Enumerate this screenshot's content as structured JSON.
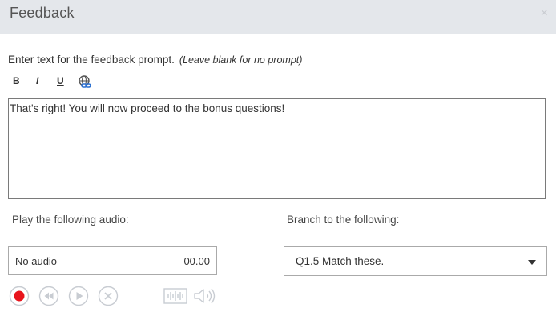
{
  "dialog": {
    "title": "Feedback",
    "close_glyph": "×"
  },
  "prompt": {
    "label": "Enter text for the feedback prompt.",
    "hint": "(Leave blank for no prompt)",
    "text": "That's right!  You will now proceed to the bonus questions!"
  },
  "toolbar": {
    "bold": "B",
    "italic": "I",
    "underline": "U",
    "link_icon": "hyperlink-icon"
  },
  "audio": {
    "label": "Play the following audio:",
    "value": "No audio",
    "time": "00.00",
    "controls": [
      "record-icon",
      "rewind-icon",
      "play-icon",
      "stop-icon",
      "waveform-icon",
      "volume-icon"
    ]
  },
  "branch": {
    "label": "Branch to the following:",
    "selected": "Q1.5 Match these."
  },
  "colors": {
    "titlebar": "#e4e7eb",
    "record": "#e8141c",
    "disabled_icon": "#c8ccd2"
  }
}
